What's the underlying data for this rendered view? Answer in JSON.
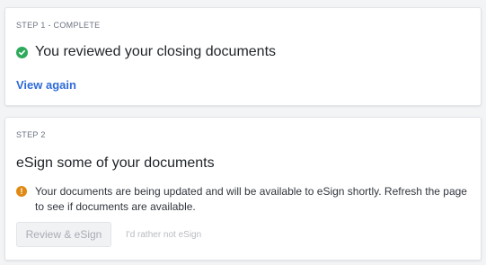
{
  "step1": {
    "label": "STEP 1 - COMPLETE",
    "title": "You reviewed your closing documents",
    "link": "View again",
    "icon": "check-circle-icon",
    "icon_color": "#2eaa5c"
  },
  "step2": {
    "label": "STEP 2",
    "title": "eSign some of your documents",
    "notice_icon": "warning-circle-icon",
    "notice_icon_glyph": "!",
    "notice_icon_color": "#e08a14",
    "notice": "Your documents are being updated and will be available to eSign shortly. Refresh the page to see if documents are available.",
    "primary_button": "Review & eSign",
    "secondary_button": "I'd rather not eSign"
  },
  "colors": {
    "link": "#2f6bd8",
    "text": "#1f2328",
    "muted": "#6b7280",
    "disabled": "#a7acb3"
  }
}
